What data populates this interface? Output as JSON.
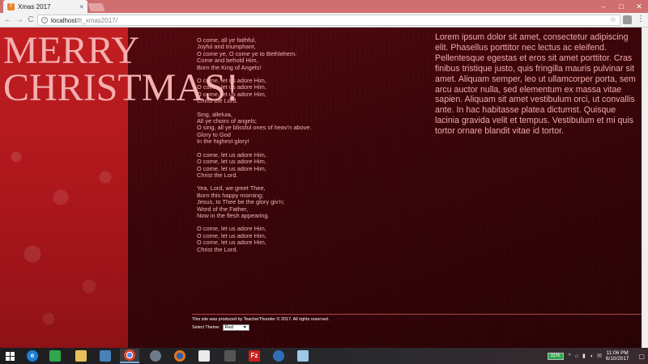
{
  "browser": {
    "tab_title": "Xmas 2017",
    "tab_close": "×",
    "favicon": "T",
    "url_host": "localhost",
    "url_path": "/tt_xmas2017/",
    "win_minimize": "–",
    "win_maximize": "□",
    "win_close": "✕",
    "back": "←",
    "forward": "→",
    "reload": "C",
    "info": "i",
    "star": "☆",
    "menu": "⋮"
  },
  "page": {
    "title_line1": "MERRY",
    "title_line2": "CHRISTMAS!",
    "lyrics": [
      [
        "O come, all ye faithful,",
        "Joyful and triumphant,",
        "O come ye, O come ye to Bethlehem.",
        "Come and behold Him,",
        "Born the King of Angels!"
      ],
      [
        "O come, let us adore Him,",
        "O come, let us adore Him,",
        "O come, let us adore Him,",
        "Christ the Lord."
      ],
      [
        "Sing, alleluia,",
        "All ye choirs of angels;",
        "O sing, all ye blissful ones of heav'n above.",
        "Glory to God",
        "In the highest glory!"
      ],
      [
        "O come, let us adore Him,",
        "O come, let us adore Him,",
        "O come, let us adore Him,",
        "Christ the Lord."
      ],
      [
        "Yea, Lord, we greet Thee,",
        "Born this happy morning;",
        "Jesus, to Thee be the glory giv'n;",
        "Word of the Father,",
        "Now in the flesh appearing."
      ],
      [
        "O come, let us adore Him,",
        "O come, let us adore Him,",
        "O come, let us adore Him,",
        "Christ the Lord."
      ]
    ],
    "lorem": "Lorem ipsum dolor sit amet, consectetur adipiscing elit. Phasellus porttitor nec lectus ac eleifend. Pellentesque egestas et eros sit amet porttitor. Cras finibus tristique justo, quis fringilla mauris pulvinar sit amet. Aliquam semper, leo ut ullamcorper porta, sem arcu auctor nulla, sed elementum ex massa vitae sapien. Aliquam sit amet vestibulum orci, ut convallis ante. In hac habitasse platea dictumst. Quisque lacinia gravida velit et tempus. Vestibulum et mi quis tortor ornare blandit vitae id tortor.",
    "footer_credit": "This site was produced by TeacherThunder © 2017. All rights reserved.",
    "theme_label": "Select Theme:",
    "theme_value": "Red",
    "theme_arrow": "▼"
  },
  "taskbar": {
    "battery": "31%",
    "time": "11:06 PM",
    "date": "6/10/2017",
    "icons": [
      "ie-icon",
      "store-icon",
      "file-explorer-icon",
      "display-icon",
      "chrome-icon",
      "app-icon",
      "firefox-icon",
      "edit-icon",
      "media-icon",
      "filezilla-icon",
      "network-icon",
      "folder-icon"
    ],
    "filezilla_glyph": "Fz",
    "tray_icons": [
      "^",
      "⌂",
      "▮",
      "◖",
      "✉"
    ],
    "notify": "▢"
  },
  "colors": {
    "accent": "#c31e22",
    "text_pink": "#f3b4b4",
    "tabbar": "#cf6f6f"
  }
}
